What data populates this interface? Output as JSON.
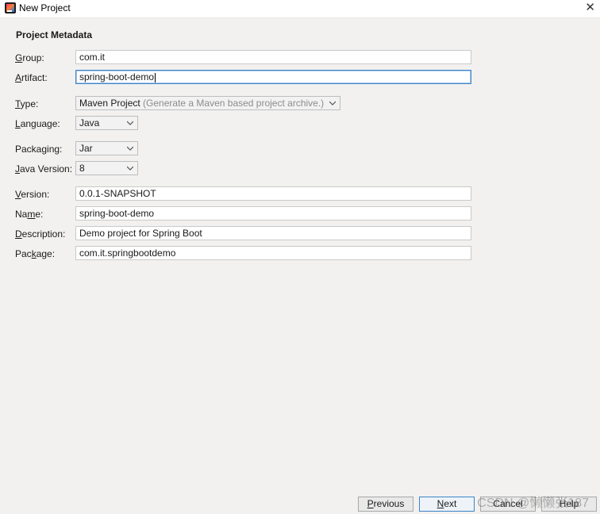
{
  "window": {
    "title": "New Project"
  },
  "section": {
    "title": "Project Metadata"
  },
  "fields": {
    "group": {
      "mnemonic": "G",
      "label_rest": "roup:",
      "value": "com.it"
    },
    "artifact": {
      "mnemonic": "A",
      "label_rest": "rtifact:",
      "value": "spring-boot-demo"
    },
    "type": {
      "mnemonic": "T",
      "label_rest": "ype:",
      "value": "Maven Project",
      "hint": "(Generate a Maven based project archive.)"
    },
    "language": {
      "mnemonic": "L",
      "label_rest": "anguage:",
      "value": "Java"
    },
    "packaging": {
      "label_pre": "Packa",
      "mnemonic": "g",
      "label_rest": "ing:",
      "value": "Jar"
    },
    "java_version": {
      "mnemonic": "J",
      "label_rest": "ava Version:",
      "value": "8"
    },
    "version": {
      "mnemonic": "V",
      "label_rest": "ersion:",
      "value": "0.0.1-SNAPSHOT"
    },
    "name": {
      "label_pre": "Na",
      "mnemonic": "m",
      "label_rest": "e:",
      "value": "spring-boot-demo"
    },
    "description": {
      "mnemonic": "D",
      "label_rest": "escription:",
      "value": "Demo project for Spring Boot"
    },
    "package": {
      "label_pre": "Pac",
      "mnemonic": "k",
      "label_rest": "age:",
      "value": "com.it.springbootdemo"
    }
  },
  "buttons": {
    "previous": {
      "mnemonic": "P",
      "label_rest": "revious"
    },
    "next": {
      "mnemonic": "N",
      "label_rest": "ext"
    },
    "cancel": {
      "label": "Cancel"
    },
    "help": {
      "label": "Help"
    }
  },
  "watermark": "CSDN @懒懒张187",
  "colors": {
    "focus": "#3d84c9",
    "background": "#f2f1f0"
  }
}
